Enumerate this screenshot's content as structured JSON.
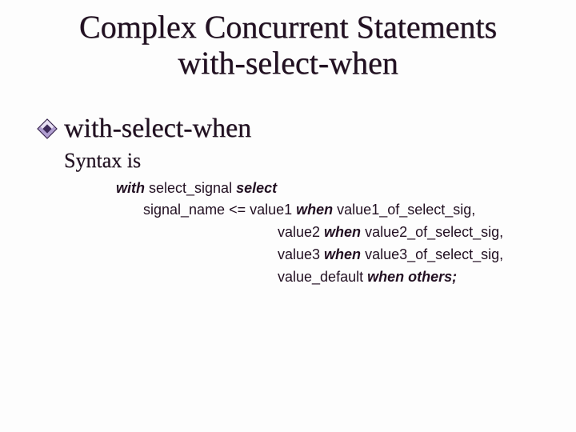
{
  "title_line1": "Complex Concurrent Statements",
  "title_line2": "with-select-when",
  "bullet_l1": "with-select-when",
  "bullet_l2": "Syntax is",
  "syntax": {
    "kw_with": "with",
    "sel_signal": " select_signal ",
    "kw_select": "select",
    "sig_name": "signal_name <= value1 ",
    "kw_when1": "when",
    "v1_sig": " value1_of_select_sig,",
    "v2": "value2 ",
    "kw_when2": "when",
    "v2_sig": " value2_of_select_sig,",
    "v3": "value3 ",
    "kw_when3": "when",
    "v3_sig": " value3_of_select_sig,",
    "vdef": "value_default ",
    "kw_when_others": "when others;"
  }
}
